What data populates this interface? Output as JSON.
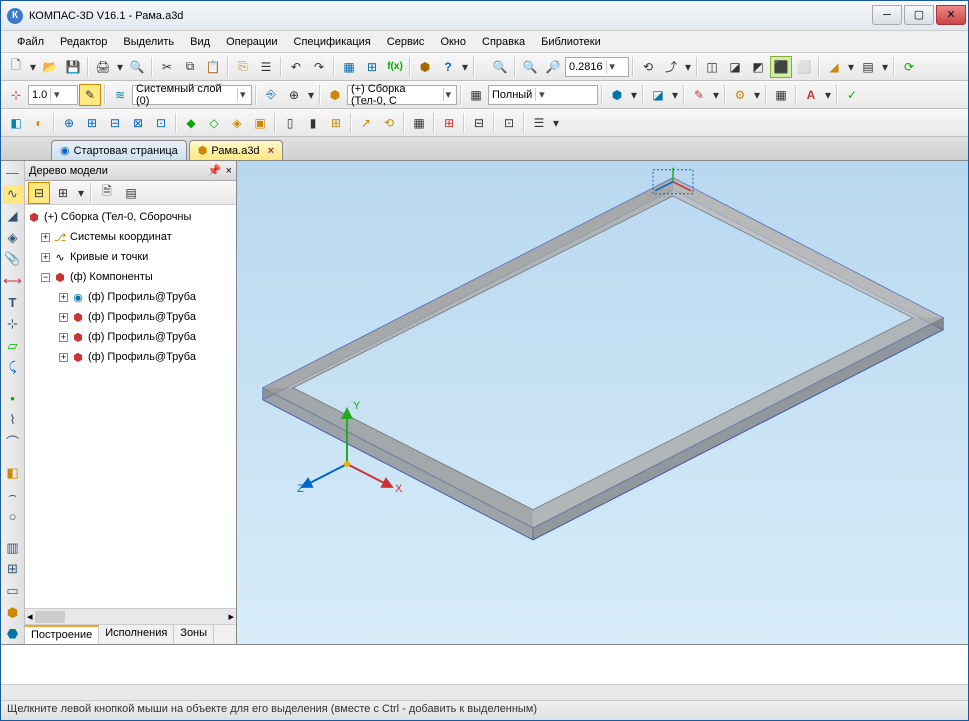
{
  "title": "КОМПАС-3D V16.1 - Рама.a3d",
  "menu": [
    "Файл",
    "Редактор",
    "Выделить",
    "Вид",
    "Операции",
    "Спецификация",
    "Сервис",
    "Окно",
    "Справка",
    "Библиотеки"
  ],
  "tb1": {
    "zoom": "0.2816"
  },
  "tb2": {
    "lw": "1.0",
    "layer": "Системный слой (0)",
    "assembly": "(+) Сборка (Тел-0, С",
    "display": "Полный"
  },
  "tabs": [
    {
      "label": "Стартовая страница",
      "active": false
    },
    {
      "label": "Рама.a3d",
      "active": true
    }
  ],
  "tree": {
    "title": "Дерево модели",
    "root": "(+) Сборка (Тел-0, Сборочны",
    "nodes": [
      {
        "label": "Системы координат",
        "indent": 1
      },
      {
        "label": "Кривые и точки",
        "indent": 1
      },
      {
        "label": "(ф) Компоненты",
        "indent": 1,
        "expanded": true
      },
      {
        "label": "(ф) Профиль@Труба",
        "indent": 2
      },
      {
        "label": "(ф) Профиль@Труба",
        "indent": 2
      },
      {
        "label": "(ф) Профиль@Труба",
        "indent": 2
      },
      {
        "label": "(ф) Профиль@Труба",
        "indent": 2
      }
    ],
    "bottabs": [
      "Построение",
      "Исполнения",
      "Зоны"
    ]
  },
  "axes": {
    "x": "X",
    "y": "Y",
    "z": "Z"
  },
  "status": "Щелкните левой кнопкой мыши на объекте для его выделения (вместе с Ctrl - добавить к выделенным)"
}
